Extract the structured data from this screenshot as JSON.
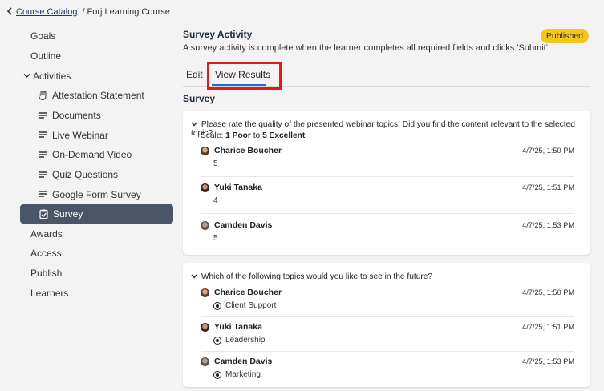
{
  "breadcrumb": {
    "link": "Course Catalog",
    "current": "/ Forj Learning Course"
  },
  "sidebar": {
    "items": [
      {
        "label": "Goals"
      },
      {
        "label": "Outline"
      },
      {
        "label": "Activities"
      },
      {
        "label": "Attestation Statement",
        "icon": "hand-icon"
      },
      {
        "label": "Documents",
        "icon": "lines-icon"
      },
      {
        "label": "Live Webinar",
        "icon": "lines-icon"
      },
      {
        "label": "On-Demand Video",
        "icon": "lines-icon"
      },
      {
        "label": "Quiz Questions",
        "icon": "lines-icon"
      },
      {
        "label": "Google Form Survey",
        "icon": "lines-icon"
      },
      {
        "label": "Survey",
        "icon": "clipboard-check-icon"
      },
      {
        "label": "Awards"
      },
      {
        "label": "Access"
      },
      {
        "label": "Publish"
      },
      {
        "label": "Learners"
      }
    ]
  },
  "main": {
    "title": "Survey Activity",
    "subtitle": "A survey activity is complete when the learner completes all required fields and clicks 'Submit'",
    "badge": "Published",
    "tabs": [
      "Edit",
      "View Results"
    ],
    "section_label": "Survey"
  },
  "questions": [
    {
      "text": "Please rate the quality of the presented webinar topics. Did you find the content relevant to the selected topic?",
      "scale_prefix": "Scale:",
      "scale_low": "1 Poor",
      "scale_to": "to",
      "scale_high": "5 Excellent",
      "responses": [
        {
          "name": "Charice Boucher",
          "value": "5",
          "time": "4/7/25, 1:50 PM"
        },
        {
          "name": "Yuki Tanaka",
          "value": "4",
          "time": "4/7/25, 1:51 PM"
        },
        {
          "name": "Camden Davis",
          "value": "5",
          "time": "4/7/25, 1:53 PM"
        }
      ]
    },
    {
      "text": "Which of the following topics would you like to see in the future?",
      "responses": [
        {
          "name": "Charice Boucher",
          "value": "Client Support",
          "time": "4/7/25, 1:50 PM"
        },
        {
          "name": "Yuki Tanaka",
          "value": "Leadership",
          "time": "4/7/25, 1:51 PM"
        },
        {
          "name": "Camden Davis",
          "value": "Marketing",
          "time": "4/7/25, 1:53 PM"
        }
      ]
    }
  ],
  "colors": {
    "accent": "#1f6ad8",
    "badge": "#f5c518",
    "active_nav": "#4a5568",
    "highlight": "#e01b1b"
  }
}
